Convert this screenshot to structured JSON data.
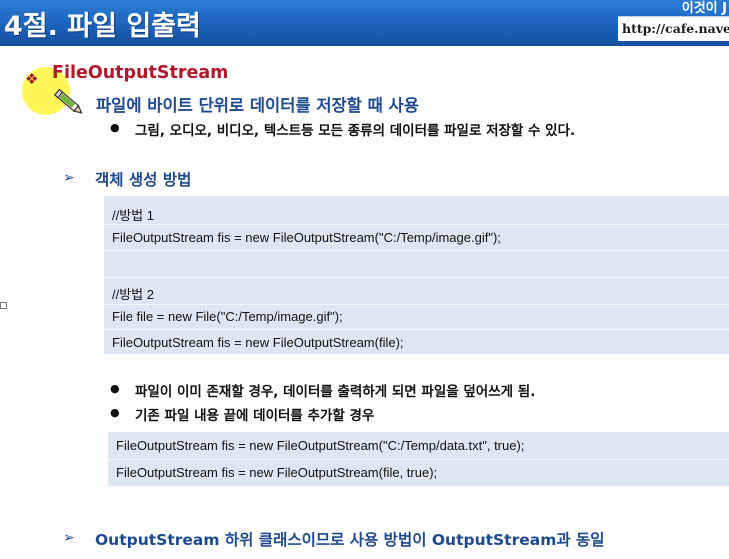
{
  "header": {
    "title": "4절. 파일 입출력",
    "top_right_text": "이것이 J",
    "url": "http://cafe.naver.c"
  },
  "section": {
    "bullet_icon": "diamond-bullet-icon",
    "title": "FileOutputStream",
    "description": "파일에 바이트 단위로 데이터를 저장할 때 사용",
    "detail_bullet": "그림, 오디오, 비디오, 텍스트등 모든 종류의 데이터를 파일로 저장할 수 있다."
  },
  "creation": {
    "heading": "객체 생성 방법",
    "code_block_1": {
      "lines": [
        "//방법 1",
        "FileOutputStream fis = new FileOutputStream(\"C:/Temp/image.gif\");",
        "",
        "//방법 2",
        "File file = new File(\"C:/Temp/image.gif\");",
        "FileOutputStream fis = new FileOutputStream(file);"
      ]
    },
    "bullets": [
      "파일이 이미 존재할 경우, 데이터를 출력하게 되면 파일을 덮어쓰게 됨.",
      "기존 파일 내용 끝에 데이터를 추가할 경우"
    ],
    "code_block_2": {
      "lines": [
        "FileOutputStream fis = new FileOutputStream(\"C:/Temp/data.txt\",  true);",
        "FileOutputStream fis = new FileOutputStream(file,  true);"
      ]
    }
  },
  "footer_heading": "OutputStream 하위 클래스이므로 사용 방법이 OutputStream과 동일",
  "colors": {
    "header_blue": "#1d63bd",
    "title_red": "#b2182b",
    "heading_blue": "#1e4a8f",
    "code_bg": "#dfe6f3",
    "cursor_highlight": "#fff546"
  }
}
